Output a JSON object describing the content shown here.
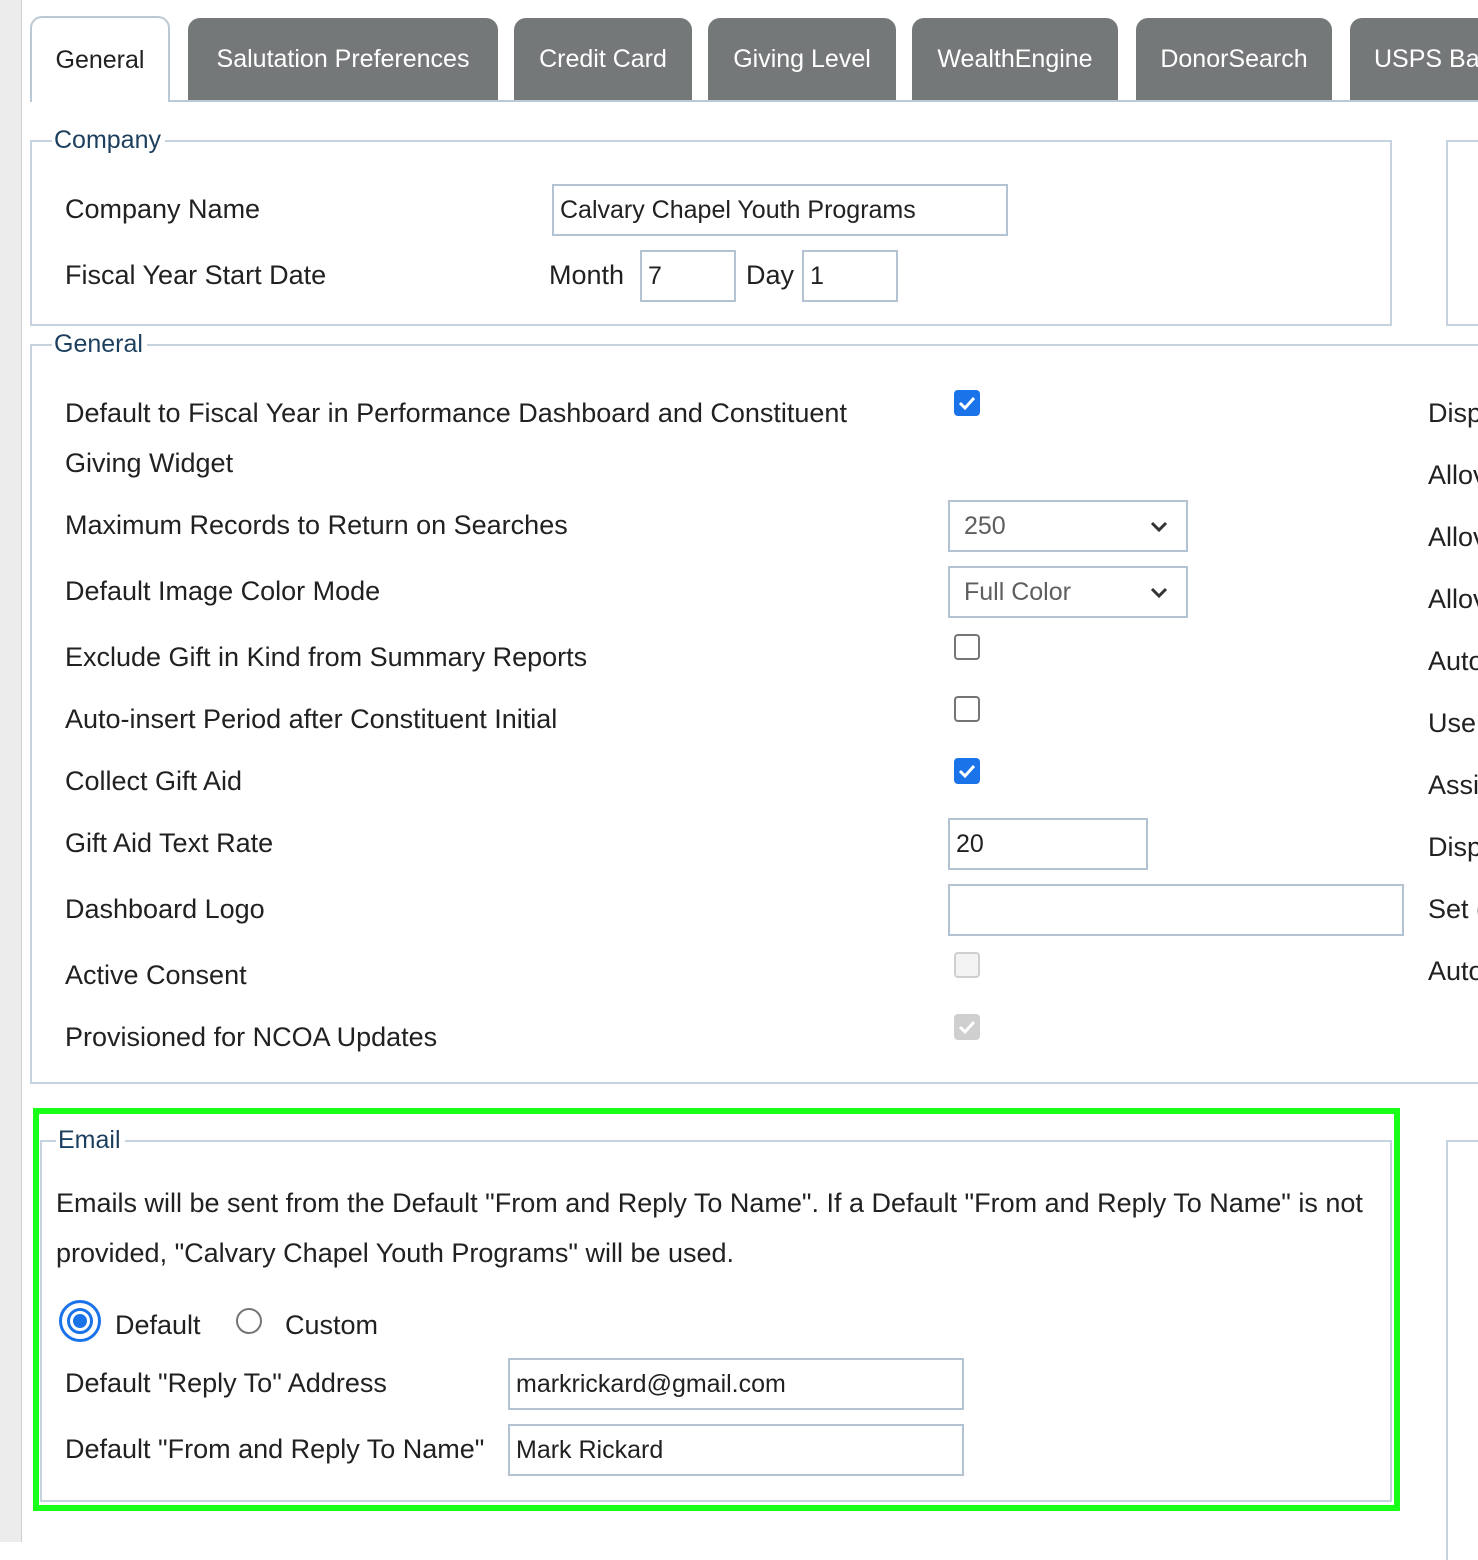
{
  "tabs": [
    {
      "label": "General",
      "active": true
    },
    {
      "label": "Salutation Preferences"
    },
    {
      "label": "Credit Card"
    },
    {
      "label": "Giving Level"
    },
    {
      "label": "WealthEngine"
    },
    {
      "label": "DonorSearch"
    },
    {
      "label": "USPS Bar"
    }
  ],
  "company": {
    "legend": "Company",
    "name_label": "Company Name",
    "name_value": "Calvary Chapel Youth Programs",
    "fiscal_label": "Fiscal Year Start Date",
    "month_label": "Month",
    "month_value": "7",
    "day_label": "Day",
    "day_value": "1"
  },
  "general": {
    "legend": "General",
    "default_fiscal_label_line1": "Default to Fiscal Year in Performance Dashboard and Constituent",
    "default_fiscal_label_line2": "Giving Widget",
    "default_fiscal_checked": true,
    "max_records_label": "Maximum Records to Return on Searches",
    "max_records_value": "250",
    "image_mode_label": "Default Image Color Mode",
    "image_mode_value": "Full Color",
    "exclude_gik_label": "Exclude Gift in Kind from Summary Reports",
    "exclude_gik_checked": false,
    "auto_period_label": "Auto-insert Period after Constituent Initial",
    "auto_period_checked": false,
    "gift_aid_label": "Collect Gift Aid",
    "gift_aid_checked": true,
    "gift_aid_rate_label": "Gift Aid Text Rate",
    "gift_aid_rate_value": "20",
    "dashboard_logo_label": "Dashboard Logo",
    "dashboard_logo_value": "",
    "active_consent_label": "Active Consent",
    "active_consent_checked": false,
    "ncoa_label": "Provisioned for NCOA Updates",
    "ncoa_checked": true
  },
  "right_column_partial": [
    "Disp",
    "Allov",
    "Allov",
    "Allov",
    "Auto",
    "Use",
    "Assi",
    "Disp",
    "Set (",
    "Auto"
  ],
  "email": {
    "legend": "Email",
    "description": "Emails will be sent from the Default \"From and Reply To Name\". If a Default \"From and Reply To Name\" is not provided, \"Calvary Chapel Youth Programs\" will be used.",
    "radio_default_label": "Default",
    "radio_custom_label": "Custom",
    "selected": "Default",
    "reply_to_label": "Default \"Reply To\" Address",
    "reply_to_value": "markrickard@gmail.com",
    "from_name_label": "Default \"From and Reply To Name\"",
    "from_name_value": "Mark Rickard"
  },
  "colors": {
    "tab_inactive": "#747879",
    "checkbox_checked": "#1a73e8",
    "legend_text": "#1d3f5e",
    "highlight": "#18ff18"
  }
}
